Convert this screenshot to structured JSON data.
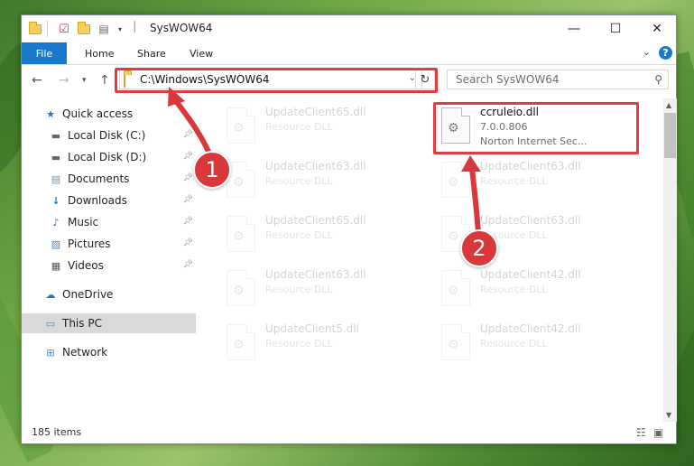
{
  "window": {
    "title": "SysWOW64",
    "controls": {
      "minimize": "—",
      "maximize": "☐",
      "close": "✕"
    }
  },
  "ribbon": {
    "tabs": [
      "File",
      "Home",
      "Share",
      "View"
    ],
    "help": "?"
  },
  "navbar": {
    "address": "C:\\Windows\\SysWOW64",
    "search_placeholder": "Search SysWOW64"
  },
  "sidebar": {
    "items": [
      {
        "label": "Quick access",
        "icon": "star-icon"
      },
      {
        "label": "Local Disk (C:)",
        "icon": "drive-icon",
        "pinned": true
      },
      {
        "label": "Local Disk (D:)",
        "icon": "drive-icon",
        "pinned": true
      },
      {
        "label": "Documents",
        "icon": "documents-icon",
        "pinned": true
      },
      {
        "label": "Downloads",
        "icon": "download-icon",
        "pinned": true
      },
      {
        "label": "Music",
        "icon": "music-icon",
        "pinned": true
      },
      {
        "label": "Pictures",
        "icon": "pictures-icon",
        "pinned": true
      },
      {
        "label": "Videos",
        "icon": "videos-icon",
        "pinned": true
      },
      {
        "label": "OneDrive",
        "icon": "cloud-icon"
      },
      {
        "label": "This PC",
        "icon": "computer-icon",
        "selected": true
      },
      {
        "label": "Network",
        "icon": "network-icon"
      }
    ]
  },
  "files": [
    {
      "name": "UpdateClient65.dll",
      "type": "Resource DLL"
    },
    {
      "name": "ccruleio.dll",
      "version": "7.0.0.806",
      "company": "Norton Internet Sec..."
    },
    {
      "name": "UpdateClient63.dll",
      "type": "Resource DLL"
    },
    {
      "name": "UpdateClient63.dll",
      "type": "Resource DLL"
    },
    {
      "name": "UpdateClient65.dll",
      "type": "Resource DLL"
    },
    {
      "name": "UpdateClient63.dll",
      "type": "Resource DLL"
    },
    {
      "name": "UpdateClient63.dll",
      "type": "Resource DLL"
    },
    {
      "name": "UpdateClient42.dll",
      "type": "Resource DLL"
    },
    {
      "name": "UpdateClient5.dll",
      "type": "Resource DLL"
    },
    {
      "name": "UpdateClient42.dll",
      "type": "Resource DLL"
    }
  ],
  "status": {
    "item_count": "185 items"
  },
  "callouts": [
    "1",
    "2"
  ],
  "colors": {
    "accent": "#1979ca",
    "highlight": "#e03c41",
    "callout": "#d8373c"
  }
}
